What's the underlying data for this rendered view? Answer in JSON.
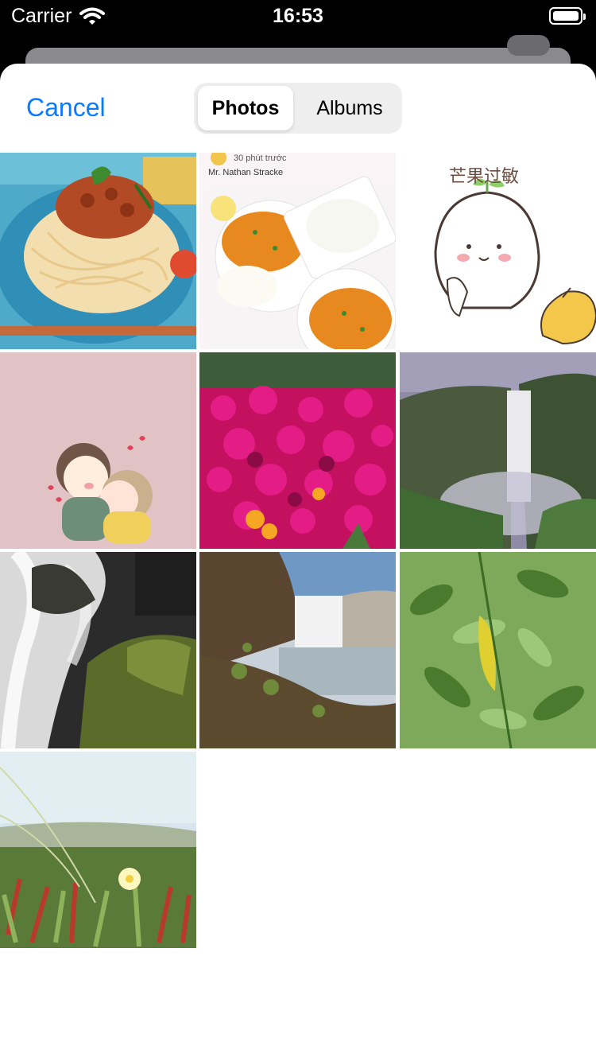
{
  "status_bar": {
    "carrier": "Carrier",
    "time": "16:53"
  },
  "nav": {
    "cancel_label": "Cancel"
  },
  "tabs": [
    {
      "label": "Photos",
      "selected": true
    },
    {
      "label": "Albums",
      "selected": false
    }
  ],
  "photos": [
    {
      "subject": "spaghetti with meat sauce"
    },
    {
      "subject": "curry with rice",
      "time_text": "30 phút trước",
      "author": "Mr. Nathan Stracke"
    },
    {
      "subject": "cartoon mango character",
      "caption": "芒果过敏"
    },
    {
      "subject": "cartoon hugging couple"
    },
    {
      "subject": "magenta flower field"
    },
    {
      "subject": "waterfall in green canyon"
    },
    {
      "subject": "long exposure waterfall over mossy rocks"
    },
    {
      "subject": "waterfall with rocky shore"
    },
    {
      "subject": "green leaves with yellow leaf"
    },
    {
      "subject": "beach grass with white flower"
    }
  ],
  "colors": {
    "accent": "#0A7AFF",
    "segment_bg": "#EEEEEF"
  }
}
